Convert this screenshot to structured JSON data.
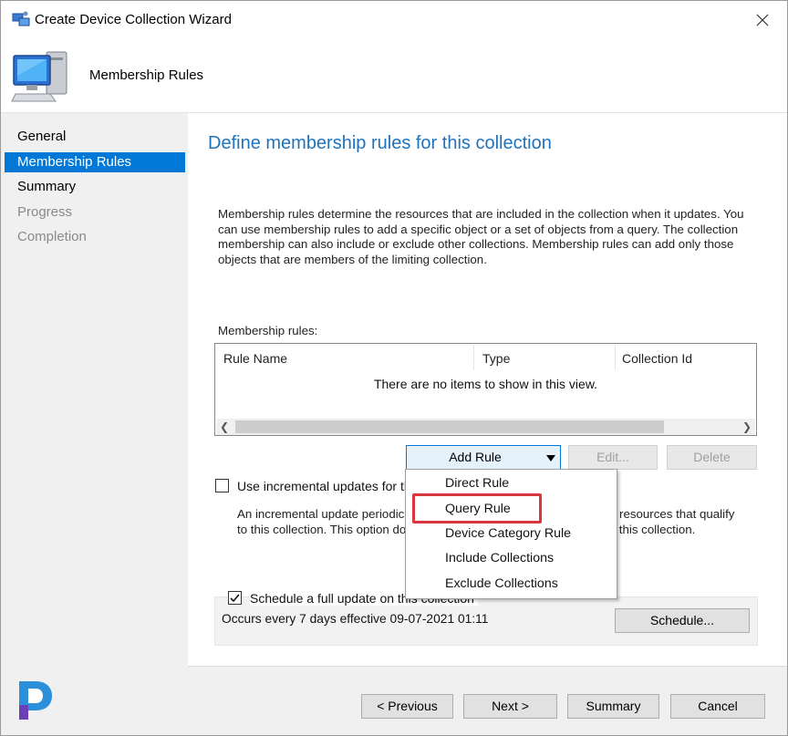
{
  "window": {
    "title": "Create Device Collection Wizard",
    "header_title": "Membership Rules"
  },
  "nav": {
    "items": [
      {
        "label": "General",
        "state": "normal"
      },
      {
        "label": "Membership Rules",
        "state": "active"
      },
      {
        "label": "Summary",
        "state": "normal"
      },
      {
        "label": "Progress",
        "state": "disabled"
      },
      {
        "label": "Completion",
        "state": "disabled"
      }
    ]
  },
  "main": {
    "page_title": "Define membership rules for this collection",
    "description": "Membership rules determine the resources that are included in the collection when it updates. You can use membership rules to add a specific object or a set of objects from a query. The collection membership can also include or exclude other collections. Membership rules can add only those objects that are members of the limiting collection.",
    "rules_label": "Membership rules:",
    "columns": [
      "Rule Name",
      "Type",
      "Collection Id"
    ],
    "empty_message": "There are no items to show in this view.",
    "add_rule_label": "Add Rule",
    "edit_label": "Edit...",
    "delete_label": "Delete",
    "incremental_label": "Use incremental updates for this",
    "incremental_desc": "An incremental update periodic                                                       adds resources that qualify to this collection. This option do                                              update for this collection.",
    "incremental_checked": false,
    "schedule_label": "Schedule a full update on this collection",
    "schedule_checked": true,
    "occurs_text": "Occurs every 7 days effective 09-07-2021 01:11",
    "schedule_button": "Schedule..."
  },
  "dropdown": {
    "items": [
      "Direct Rule",
      "Query Rule",
      "Device Category Rule",
      "Include Collections",
      "Exclude Collections"
    ],
    "highlighted": "Query Rule"
  },
  "footer": {
    "previous_label": "< Previous",
    "next_label": "Next >",
    "summary_label": "Summary",
    "cancel_label": "Cancel"
  },
  "colors": {
    "accent": "#0078d7",
    "title_blue": "#1e73be",
    "highlight_red": "#d9363e"
  },
  "icons": {
    "title": "wizard-icon",
    "header": "computer-icon",
    "close": "close-icon",
    "logo": "prajwal-logo-icon"
  }
}
